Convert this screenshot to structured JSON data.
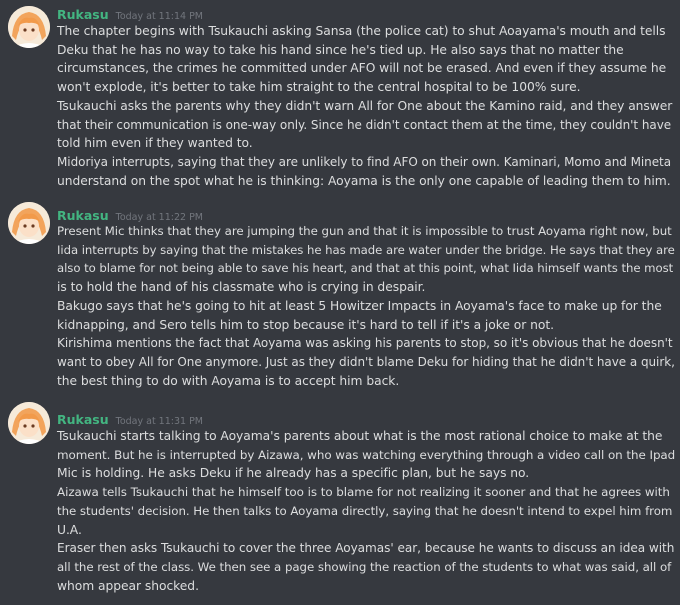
{
  "messages": [
    {
      "author": "Rukasu",
      "timestamp": "Today at 11:14 PM",
      "lines": [
        "The chapter begins with Tsukauchi asking Sansa (the police cat) to shut Aoayama's mouth and tells",
        "Deku that he has no way to take his hand since he's tied up. He also says that no matter the",
        "circumstances, the crimes he committed under AFO will not be erased. And even if they assume he",
        "won't explode, it's better to take him straight to the central hospital to be 100% sure.",
        "Tsukauchi asks the parents why they didn't warn All for One about the Kamino raid, and they answer",
        "that their communication is one-way only. Since he didn't contact them at the time, they couldn't have",
        "told him even if they wanted to.",
        "Midoriya interrupts, saying that they are unlikely to find AFO on their own. Kaminari, Momo and Mineta",
        "understand on the spot what he is thinking: Aoyama is the only one capable of leading them to him."
      ]
    },
    {
      "author": "Rukasu",
      "timestamp": "Today at 11:22 PM",
      "lines": [
        "Present Mic thinks that they are jumping the gun and that it is impossible to trust Aoyama right now, but",
        "Iida interrupts by saying that the mistakes he has made are water under the bridge. He says that they are",
        "also to blame for not being able to save his heart, and that at this point, what Iida himself wants the most",
        "is to hold the hand of his classmate who is crying in despair.",
        "Bakugo says that he's going to hit at least 5 Howitzer Impacts in Aoyama's face to make up for the",
        "kidnapping, and Sero tells him to stop because it's hard to tell if it's a joke or not.",
        "Kirishima mentions the fact that Aoyama was asking his parents to stop, so it's obvious that he doesn't",
        "want to obey All for One anymore. Just as they didn't blame Deku for hiding that he didn't have a quirk,",
        "the best thing to do with Aoyama is to accept him back."
      ]
    },
    {
      "author": "Rukasu",
      "timestamp": "Today at 11:31 PM",
      "lines": [
        "Tsukauchi starts talking to Aoyama's parents about what is the most rational choice to make at the",
        "moment. But he is interrupted by Aizawa, who was watching everything through a video call on the Ipad",
        "Mic is holding. He asks Deku if he already has a specific plan, but he says no.",
        "Aizawa tells Tsukauchi that he himself too is to blame for not realizing it sooner and that he agrees with",
        "the students' decision. He then talks to Aoyama directly, saying that he doesn't intend to expel him from",
        "U.A.",
        "Eraser then asks Tsukauchi to cover the three Aoyamas' ear, because he wants to discuss an idea with",
        "all the rest of the class. We then see a page showing the reaction of the students to what was said, all of",
        "whom appear shocked."
      ]
    }
  ]
}
